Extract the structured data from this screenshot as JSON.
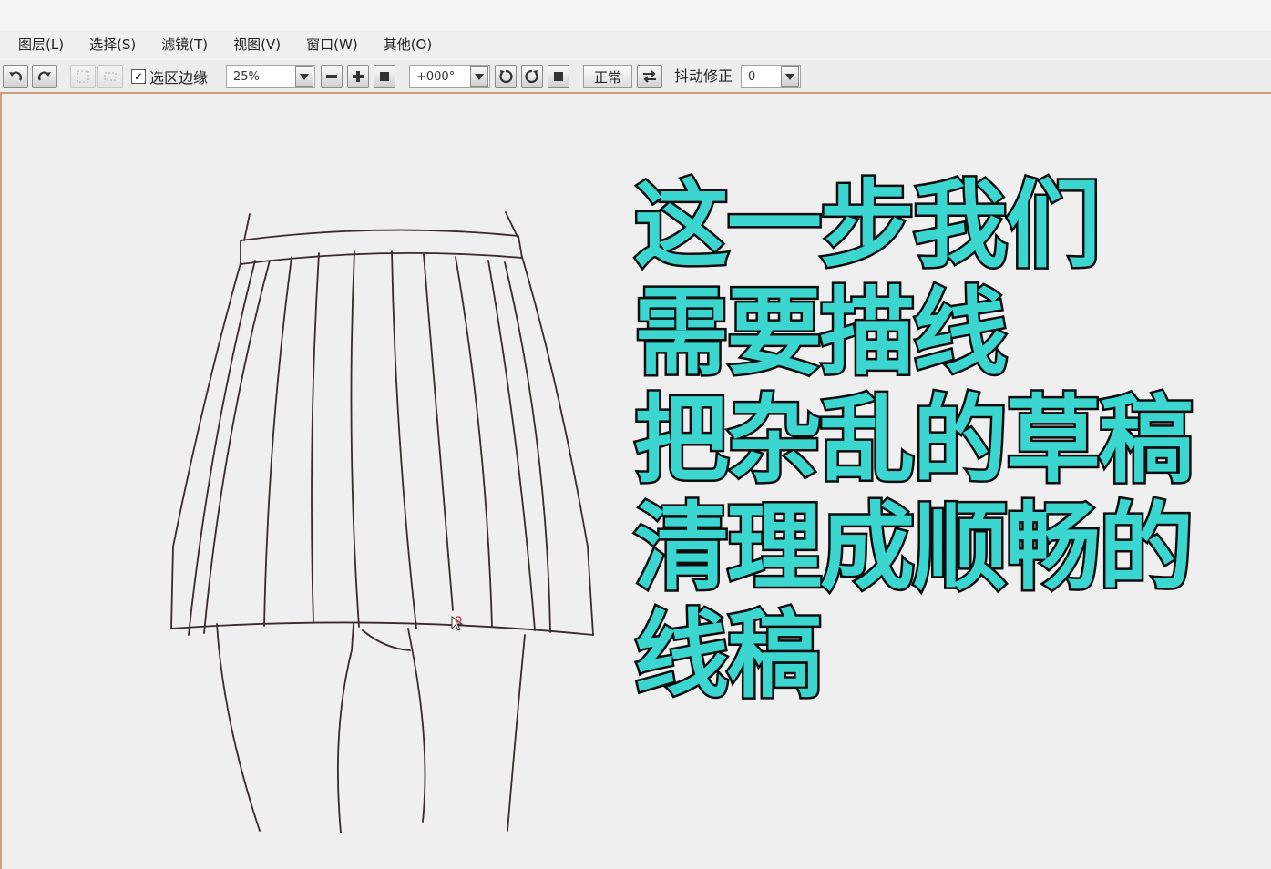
{
  "menubar": {
    "items": [
      "图层(L)",
      "选择(S)",
      "滤镜(T)",
      "视图(V)",
      "窗口(W)",
      "其他(O)"
    ]
  },
  "toolbar": {
    "selection_edge_label": "选区边缘",
    "selection_edge_checked": true,
    "zoom_value": "25%",
    "rotation_value": "+000°",
    "blend_mode_label": "正常",
    "stabilizer_label": "抖动修正",
    "stabilizer_value": "0"
  },
  "caption": {
    "lines": [
      "这一步我们",
      "需要描线",
      "把杂乱的草稿",
      "清理成顺畅的",
      "线稿"
    ]
  },
  "colors": {
    "caption_fill": "#3bd6cf",
    "caption_outline": "#0c0c0c",
    "line_art": "#3a2a2a",
    "canvas_border": "#cf9f86"
  },
  "icons": {
    "undo": "undo-icon",
    "redo": "redo-icon",
    "zoom_out": "minus-icon",
    "zoom_in": "plus-icon",
    "rotate_left": "rotate-left-icon",
    "rotate_right": "rotate-right-icon",
    "flip": "flip-horizontal-icon",
    "cursor": "pen-cursor-icon"
  }
}
